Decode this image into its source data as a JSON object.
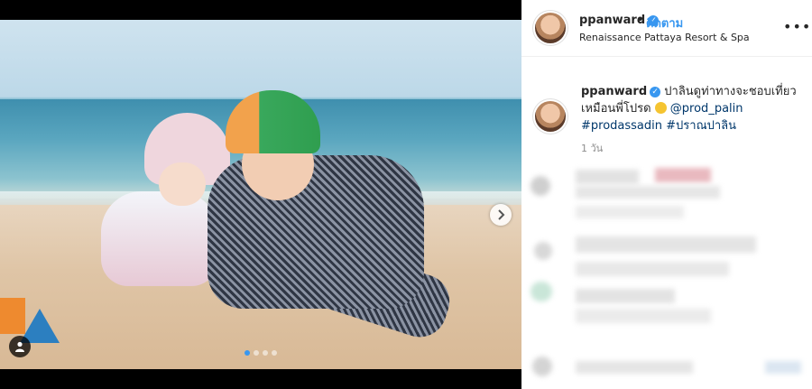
{
  "post": {
    "username": "ppanward",
    "separator": "•",
    "follow_label": "ติดตาม",
    "location": "Renaissance Pattaya Resort & Spa",
    "more_label": "•••",
    "caption_text": "ปาลินดูท่าทางจะชอบเที่ยว เหมือนพี่โปรด",
    "mention": "@prod_palin",
    "hashtag_1": "#prodassadin",
    "hashtag_2": "#ปราณปาลิน",
    "time": "1 วัน"
  },
  "carousel": {
    "dot_count": 4,
    "active_index": 0
  },
  "colors": {
    "accent": "#3897f0",
    "link": "#00376b",
    "muted": "#8e8e8e"
  },
  "icons": {
    "verified": "verified-badge-icon",
    "next": "chevron-right-icon",
    "user_tag": "person-icon",
    "more": "ellipsis-icon"
  }
}
